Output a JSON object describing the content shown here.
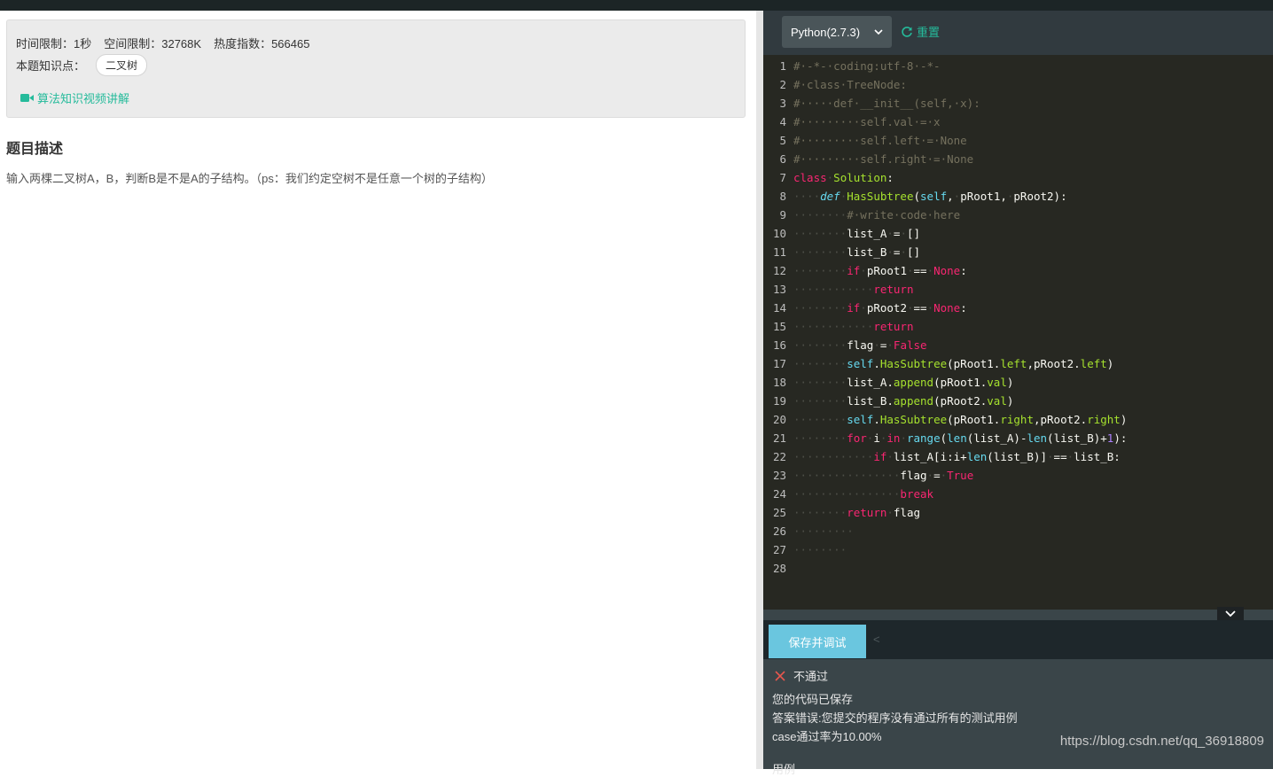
{
  "problem": {
    "time_limit": "时间限制：1秒",
    "space_limit": "空间限制：32768K",
    "heat_index": "热度指数：566465",
    "topics_label": "本题知识点：",
    "topic_tag": "二叉树",
    "video_link": "算法知识视频讲解",
    "section_title": "题目描述",
    "description": "输入两棵二叉树A，B，判断B是不是A的子结构。（ps：我们约定空树不是任意一个树的子结构）"
  },
  "editor": {
    "language": "Python(2.7.3)",
    "reset_label": "重置",
    "code_lines": [
      "# -*- coding:utf-8 -*-",
      "# class TreeNode:",
      "#     def __init__(self, x):",
      "#         self.val = x",
      "#         self.left = None",
      "#         self.right = None",
      "class Solution:",
      "    def HasSubtree(self, pRoot1, pRoot2):",
      "        # write code here",
      "        list_A = []",
      "        list_B = []",
      "        if pRoot1 == None:",
      "            return",
      "        if pRoot2 == None:",
      "            return",
      "        flag = False",
      "        self.HasSubtree(pRoot1.left,pRoot2.left)",
      "        list_A.append(pRoot1.val)",
      "        list_B.append(pRoot2.val)",
      "        self.HasSubtree(pRoot1.right,pRoot2.right)",
      "        for i in range(len(list_A)-len(list_B)+1):",
      "            if list_A[i:i+len(list_B)] == list_B:",
      "                flag = True",
      "                break",
      "        return flag",
      "         ",
      "        ",
      ""
    ]
  },
  "actions": {
    "save_debug": "保存并调试",
    "small_arrow": "<"
  },
  "result": {
    "status": "不通过",
    "saved": "您的代码已保存",
    "error": "答案错误:您提交的程序没有通过所有的测试用例",
    "pass_rate": "case通过率为10.00%",
    "cut_text": "用例"
  },
  "watermark": "https://blog.csdn.net/qq_36918809",
  "colors": {
    "accent_green": "#25bb9b",
    "save_button": "#6ac6df",
    "editor_bg": "#272822",
    "fail_red": "#e8574e"
  },
  "icons": {
    "video": "video-camera-icon",
    "reset": "refresh-icon",
    "dropdown": "chevron-down-icon",
    "collapse": "chevron-down-icon",
    "status": "close-icon"
  }
}
